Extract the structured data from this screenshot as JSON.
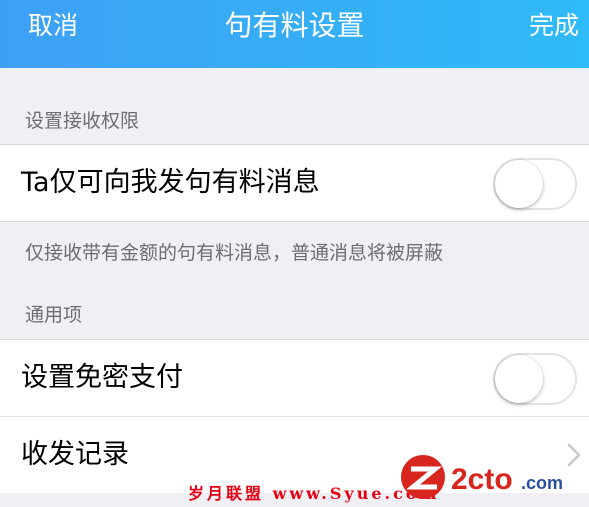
{
  "nav": {
    "cancel": "取消",
    "title": "句有料设置",
    "done": "完成"
  },
  "sections": [
    {
      "header": "设置接收权限",
      "rows": [
        {
          "label": "Ta仅可向我发句有料消息",
          "switch_on": false
        }
      ],
      "footer": "仅接收带有金额的句有料消息，普通消息将被屏蔽"
    },
    {
      "header": "通用项",
      "rows": [
        {
          "label": "设置免密支付",
          "switch_on": false
        },
        {
          "label": "收发记录"
        }
      ]
    }
  ],
  "watermark": {
    "text": "岁月联盟 www.Syue.com",
    "logo_text": "2cto.com"
  },
  "colors": {
    "nav_start": "#3ea0f5",
    "nav_end": "#2fbaf8",
    "background": "#efeff4",
    "watermark_red": "#e60012"
  }
}
